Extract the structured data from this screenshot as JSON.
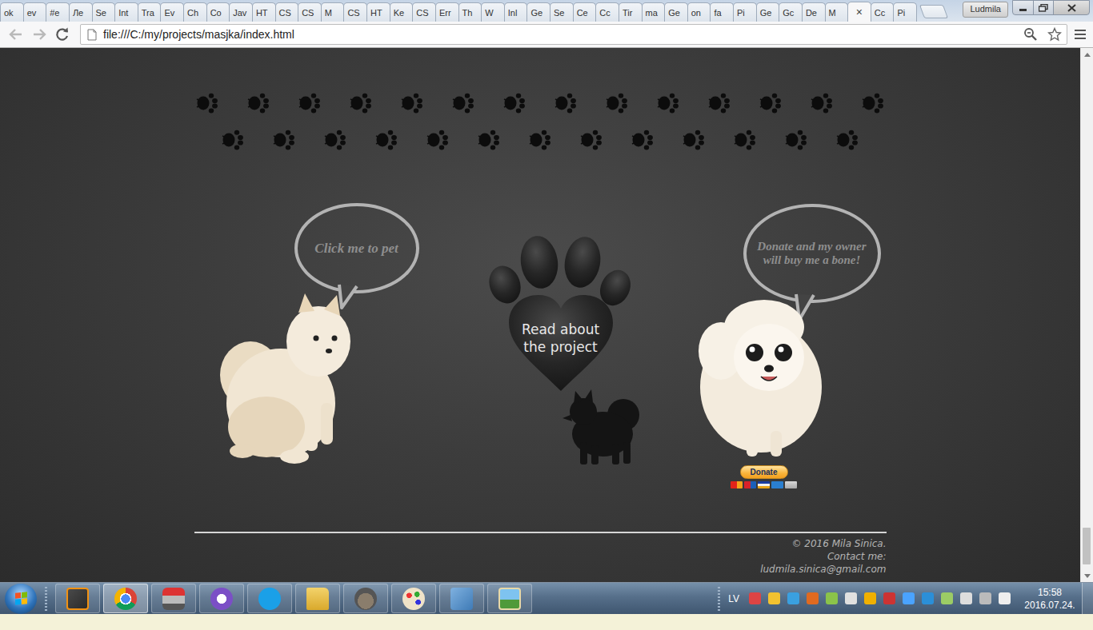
{
  "browser": {
    "tabs": [
      {
        "label": "ok",
        "selected": false
      },
      {
        "label": "ev",
        "selected": false
      },
      {
        "label": "#e",
        "selected": false
      },
      {
        "label": "Ле",
        "selected": false
      },
      {
        "label": "Se",
        "selected": false
      },
      {
        "label": "Int",
        "selected": false
      },
      {
        "label": "Tra",
        "selected": false
      },
      {
        "label": "Ev",
        "selected": false
      },
      {
        "label": "Ch",
        "selected": false
      },
      {
        "label": "Co",
        "selected": false
      },
      {
        "label": "Jav",
        "selected": false
      },
      {
        "label": "HT",
        "selected": false
      },
      {
        "label": "CS",
        "selected": false
      },
      {
        "label": "CS",
        "selected": false
      },
      {
        "label": "M",
        "selected": false
      },
      {
        "label": "CS",
        "selected": false
      },
      {
        "label": "HT",
        "selected": false
      },
      {
        "label": "Ke",
        "selected": false
      },
      {
        "label": "CS",
        "selected": false
      },
      {
        "label": "Err",
        "selected": false
      },
      {
        "label": "Th",
        "selected": false
      },
      {
        "label": "W",
        "selected": false
      },
      {
        "label": "Inl",
        "selected": false
      },
      {
        "label": "Ge",
        "selected": false
      },
      {
        "label": "Se",
        "selected": false
      },
      {
        "label": "Ce",
        "selected": false
      },
      {
        "label": "Cc",
        "selected": false
      },
      {
        "label": "Tir",
        "selected": false
      },
      {
        "label": "ma",
        "selected": false
      },
      {
        "label": "Ge",
        "selected": false
      },
      {
        "label": "on",
        "selected": false
      },
      {
        "label": "fa",
        "selected": false
      },
      {
        "label": "Pi",
        "selected": false
      },
      {
        "label": "Ge",
        "selected": false
      },
      {
        "label": "Gc",
        "selected": false
      },
      {
        "label": "De",
        "selected": false
      },
      {
        "label": "M",
        "selected": false
      },
      {
        "label": "",
        "selected": true
      },
      {
        "label": "Cc",
        "selected": false
      },
      {
        "label": "Pi",
        "selected": false
      }
    ],
    "tab_close": "×",
    "profile": "Ludmila",
    "url": "file:///C:/my/projects/masjka/index.html"
  },
  "page": {
    "paw_rows": [
      {
        "count": 14
      },
      {
        "count": 13
      }
    ],
    "pet_bubble": "Click me to pet",
    "donate_bubble": "Donate and my owner will buy me a bone!",
    "project_link": "Read about the project",
    "donate_button": "Donate",
    "footer": {
      "copyright": "© 2016 Mila Sinica.",
      "contact": "Contact me:",
      "email": "ludmila.sinica@gmail.com"
    }
  },
  "scrollbar": {
    "position": 0.99,
    "thumb": 0.072
  },
  "taskbar": {
    "apps": [
      {
        "selected": false
      },
      {
        "selected": true
      },
      {
        "selected": false
      },
      {
        "selected": false
      },
      {
        "selected": false
      },
      {
        "selected": false
      },
      {
        "selected": false
      },
      {
        "selected": false
      },
      {
        "selected": false
      },
      {
        "selected": false
      }
    ],
    "language": "LV",
    "time": "15:58",
    "date": "2016.07.24."
  }
}
